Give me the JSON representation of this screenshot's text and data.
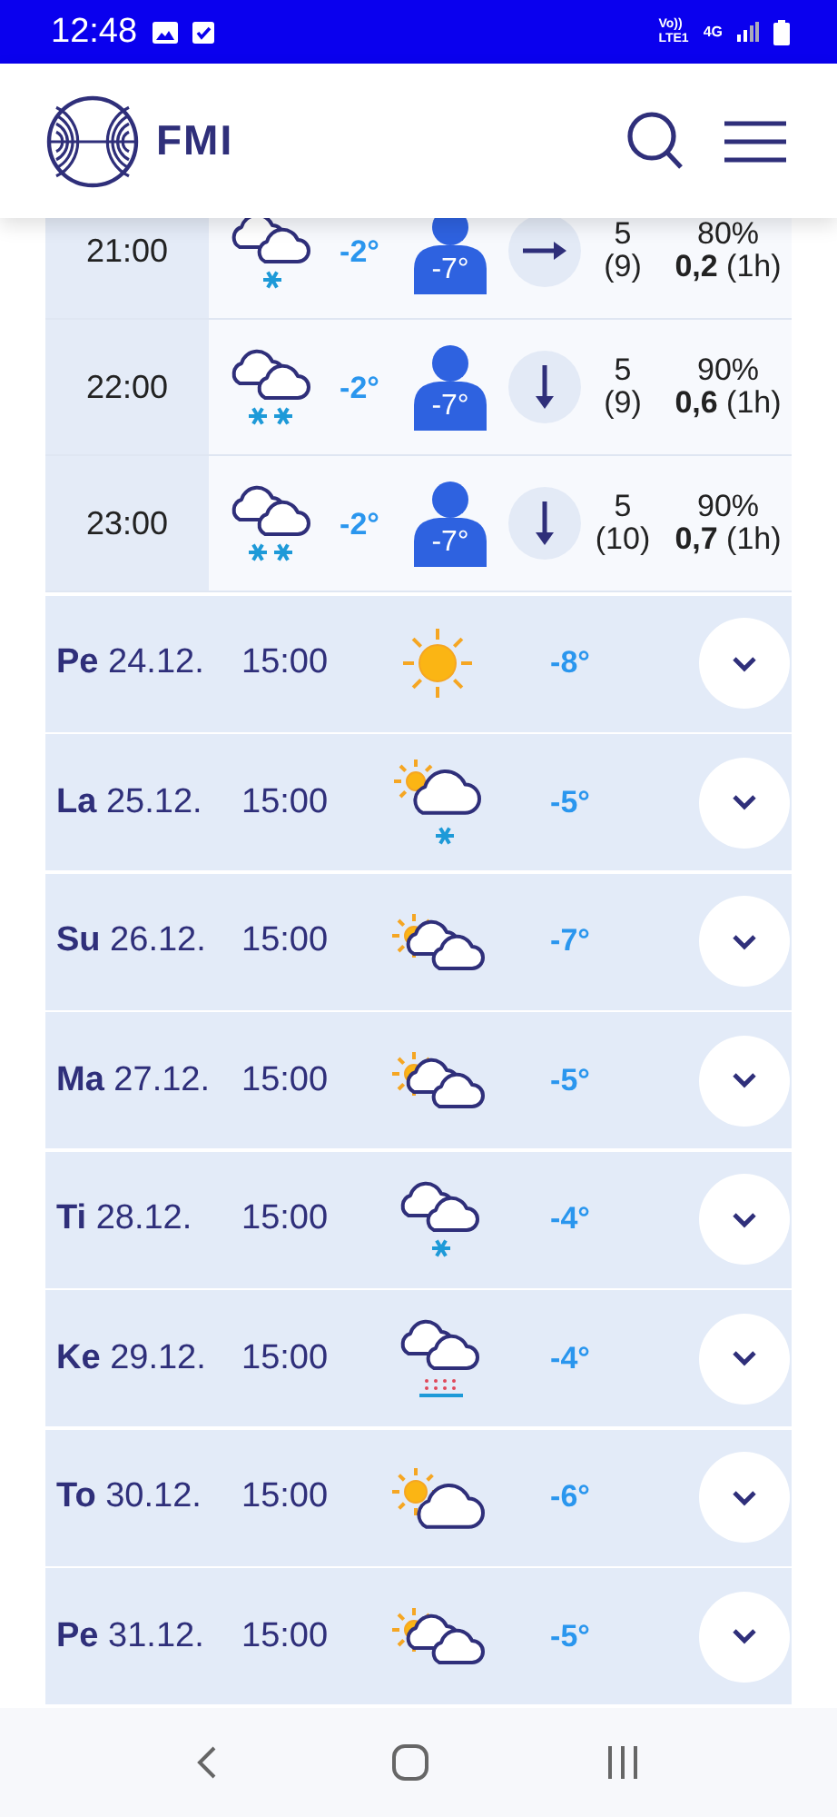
{
  "status_bar": {
    "time": "12:48",
    "volte": "Vo))",
    "lte": "LTE1",
    "network": "4G"
  },
  "header": {
    "logo_text": "FMI"
  },
  "hourly": [
    {
      "time": "21:00",
      "weather": {
        "kind": "cloudy_light_snow"
      },
      "temperature": "-2°",
      "feels_like": "-7°",
      "wind": {
        "kind": "right"
      },
      "wind_speed": "5",
      "wind_gust": "(9)",
      "humidity": "80%",
      "precipitation": "**0,2** (1h)"
    },
    {
      "time": "22:00",
      "weather": {
        "kind": "cloudy_snow"
      },
      "temperature": "-2°",
      "feels_like": "-7°",
      "wind": {
        "kind": "down"
      },
      "wind_speed": "5",
      "wind_gust": "(9)",
      "humidity": "90%",
      "precipitation": "**0,6** (1h)"
    },
    {
      "time": "23:00",
      "weather": {
        "kind": "cloudy_snow"
      },
      "temperature": "-2°",
      "feels_like": "-7°",
      "wind": {
        "kind": "down"
      },
      "wind_speed": "5",
      "wind_gust": "(10)",
      "humidity": "90%",
      "precipitation": "**0,7** (1h)"
    }
  ],
  "daily": [
    {
      "day": "**Pe** 24.12.",
      "time": "15:00",
      "weather": {
        "kind": "clear"
      },
      "temperature": "-8°"
    },
    {
      "day": "**La** 25.12.",
      "time": "15:00",
      "weather": {
        "kind": "partly_cloudy_light_snow"
      },
      "temperature": "-5°"
    },
    {
      "day": "**Su** 26.12.",
      "time": "15:00",
      "weather": {
        "kind": "partly_cloudy"
      },
      "temperature": "-7°"
    },
    {
      "day": "**Ma** 27.12.",
      "time": "15:00",
      "weather": {
        "kind": "partly_cloudy"
      },
      "temperature": "-5°"
    },
    {
      "day": "**Ti** 28.12.",
      "time": "15:00",
      "weather": {
        "kind": "cloudy_light_snow"
      },
      "temperature": "-4°"
    },
    {
      "day": "**Ke** 29.12.",
      "time": "15:00",
      "weather": {
        "kind": "cloudy_sleet"
      },
      "temperature": "-4°"
    },
    {
      "day": "**To** 30.12.",
      "time": "15:00",
      "weather": {
        "kind": "half_cloudy"
      },
      "temperature": "-6°"
    },
    {
      "day": "**Pe** 31.12.",
      "time": "15:00",
      "weather": {
        "kind": "partly_cloudy"
      },
      "temperature": "-5°"
    }
  ]
}
